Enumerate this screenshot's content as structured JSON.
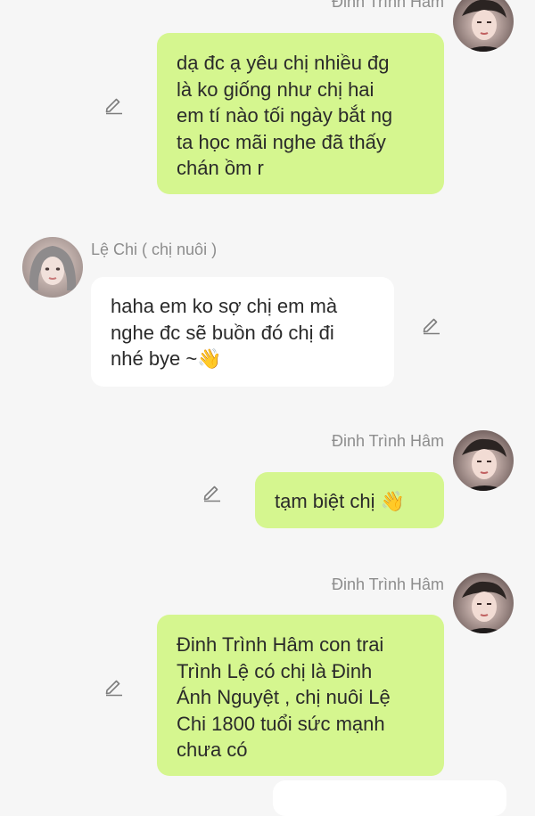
{
  "messages": [
    {
      "sender": "Đinh Trình Hâm",
      "lines": [
        "dạ đc ạ yêu chị nhiều đg",
        "là ko giống  như chị hai",
        "em tí nào tối ngày bắt ng",
        "ta học mãi nghe đã thấy",
        "chán ồm r"
      ]
    },
    {
      "sender": "Lệ Chi ( chị nuôi )",
      "lines": [
        "haha em ko sợ chị em mà",
        "nghe đc sẽ buồn đó chị đi",
        "nhé bye ~👋"
      ]
    },
    {
      "sender": "Đinh Trình Hâm",
      "lines": [
        "tạm biệt chị 👋"
      ]
    },
    {
      "sender": "Đinh Trình Hâm",
      "lines": [
        "Đinh Trình Hâm con trai",
        "Trình Lệ có chị là Đinh",
        "Ánh Nguyệt , chị nuôi Lệ",
        "Chi 1800 tuổi  sức mạnh",
        "chưa có"
      ]
    }
  ],
  "icons": {
    "edit": "pencil-edit-icon"
  },
  "colors": {
    "outgoing_bubble": "#d5f68f",
    "incoming_bubble": "#ffffff",
    "background": "#f6f6f6",
    "name_text": "#8d8d8d"
  }
}
